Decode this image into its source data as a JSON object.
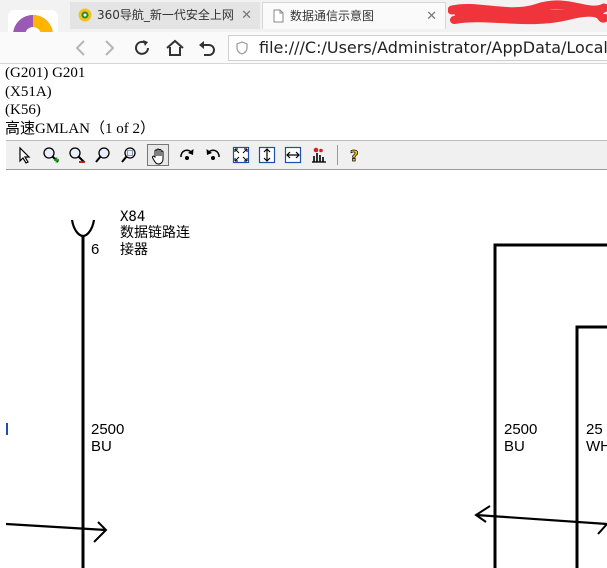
{
  "browser": {
    "tabs": [
      {
        "title": "360导航_新一代安全上网",
        "icon": "360-browser-icon"
      },
      {
        "title": "数据通信示意图",
        "icon": "page-icon"
      }
    ],
    "address": "file:///C:/Users/Administrator/AppData/Local/Te"
  },
  "document": {
    "lines": [
      "(G201) G201",
      "(X51A)",
      "(K56)",
      "高速GMLAN（1 of 2）"
    ]
  },
  "viewer_toolbar": {
    "tools": [
      "select-tool",
      "zoom-in-tool",
      "zoom-out-tool",
      "zoom-tool",
      "zoom-area-tool",
      "pan-tool",
      "rotate-right-tool",
      "rotate-left-tool",
      "fit-page-tool",
      "fit-height-tool",
      "fit-width-tool",
      "layers-tool",
      "help-tool"
    ],
    "active_tool": "pan-tool"
  },
  "diagram": {
    "connector_id": "X84",
    "connector_name_line1": "数据链路连",
    "connector_name_line2": "接器",
    "pin": "6",
    "wires": [
      {
        "gauge": "2500",
        "color": "BU"
      },
      {
        "gauge": "2500",
        "color": "BU"
      },
      {
        "gauge": "25",
        "color": "WH"
      }
    ]
  }
}
